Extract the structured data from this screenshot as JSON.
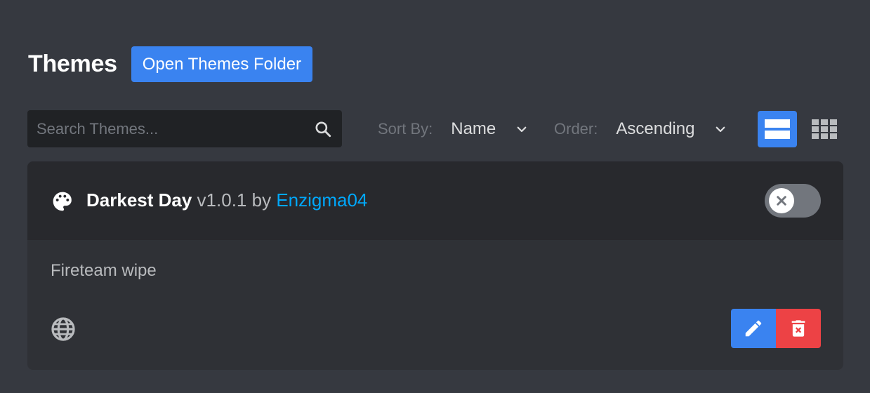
{
  "header": {
    "title": "Themes",
    "open_folder_label": "Open Themes Folder"
  },
  "search": {
    "placeholder": "Search Themes...",
    "value": ""
  },
  "sort": {
    "label": "Sort By:",
    "value": "Name"
  },
  "order": {
    "label": "Order:",
    "value": "Ascending"
  },
  "view": {
    "selected": "list"
  },
  "theme": {
    "name": "Darkest Day",
    "version": "v1.0.1",
    "by": "by",
    "author": "Enzigma04",
    "description": "Fireteam wipe",
    "enabled": false
  },
  "colors": {
    "accent": "#3a83f0",
    "link": "#00a8fc",
    "danger": "#ed4245",
    "background": "#363940",
    "card": "#2f3136"
  },
  "icons": {
    "search": "search-icon",
    "palette": "palette-icon",
    "globe": "globe-icon",
    "edit": "pencil-icon",
    "delete": "trash-icon"
  }
}
